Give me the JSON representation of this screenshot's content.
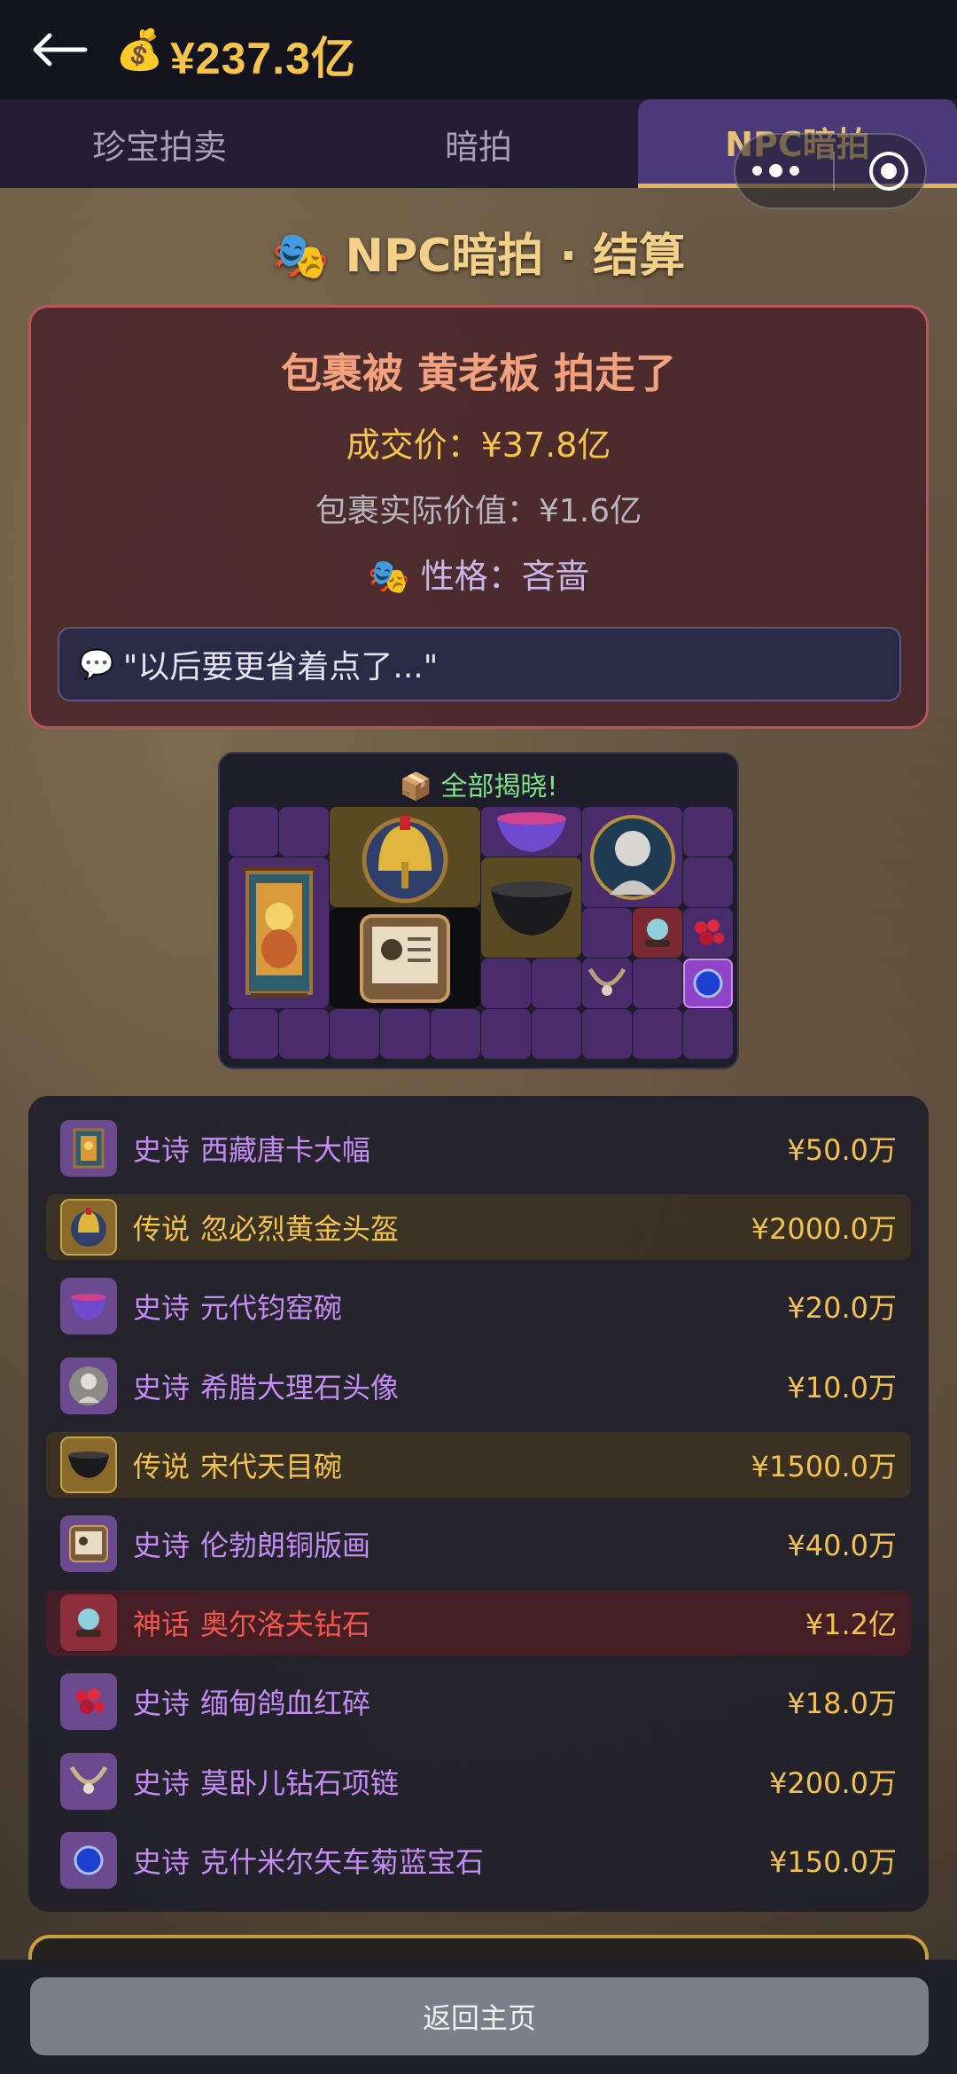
{
  "header": {
    "money": "¥237.3亿",
    "money_icon": "money-bag-icon"
  },
  "tabs": [
    {
      "label": "珍宝拍卖",
      "active": false
    },
    {
      "label": "暗拍",
      "active": false
    },
    {
      "label": "NPC暗拍",
      "active": true
    }
  ],
  "page_title": "NPC暗拍 · 结算",
  "result": {
    "title": "包裹被 黄老板 拍走了",
    "price": "成交价：¥37.8亿",
    "actual_value": "包裹实际价值：¥1.6亿",
    "trait": "性格：吝啬",
    "quote": "\"以后要更省着点了...\""
  },
  "reveal": {
    "title": "全部揭晓!"
  },
  "items": [
    {
      "tier": "史诗",
      "name": "西藏唐卡大幅",
      "price": "¥50.0万",
      "rarity": "epic",
      "icon": "thangka-icon"
    },
    {
      "tier": "传说",
      "name": "忽必烈黄金头盔",
      "price": "¥2000.0万",
      "rarity": "legend",
      "icon": "helmet-icon"
    },
    {
      "tier": "史诗",
      "name": "元代钧窑碗",
      "price": "¥20.0万",
      "rarity": "epic",
      "icon": "bowl-icon"
    },
    {
      "tier": "史诗",
      "name": "希腊大理石头像",
      "price": "¥10.0万",
      "rarity": "epic",
      "icon": "bust-icon"
    },
    {
      "tier": "传说",
      "name": "宋代天目碗",
      "price": "¥1500.0万",
      "rarity": "legend",
      "icon": "black-bowl-icon"
    },
    {
      "tier": "史诗",
      "name": "伦勃朗铜版画",
      "price": "¥40.0万",
      "rarity": "epic",
      "icon": "etching-icon"
    },
    {
      "tier": "神话",
      "name": "奥尔洛夫钻石",
      "price": "¥1.2亿",
      "rarity": "myth",
      "icon": "diamond-icon"
    },
    {
      "tier": "史诗",
      "name": "缅甸鸽血红碎",
      "price": "¥18.0万",
      "rarity": "epic",
      "icon": "ruby-icon"
    },
    {
      "tier": "史诗",
      "name": "莫卧儿钻石项链",
      "price": "¥200.0万",
      "rarity": "epic",
      "icon": "necklace-icon"
    },
    {
      "tier": "史诗",
      "name": "克什米尔矢车菊蓝宝石",
      "price": "¥150.0万",
      "rarity": "epic",
      "icon": "sapphire-icon"
    }
  ],
  "footer": {
    "home_label": "返回主页"
  },
  "colors": {
    "epic": "#c58cf4",
    "legend": "#f4c24f",
    "myth": "#f3564f",
    "price": "#f3c24e"
  }
}
